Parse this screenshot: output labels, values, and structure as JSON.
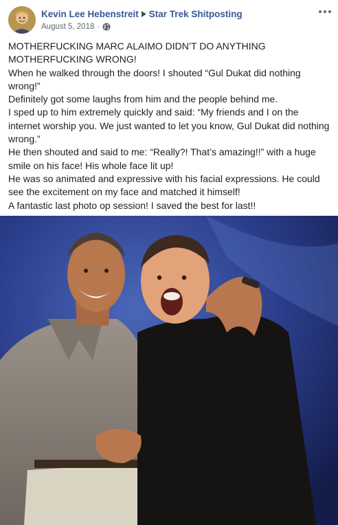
{
  "post": {
    "author": "Kevin Lee Hebenstreit",
    "group": "Star Trek Shitposting",
    "date": "August 5, 2018",
    "date_separator": "·",
    "icons": {
      "separator": "triangle-right-icon",
      "privacy": "globe-icon",
      "menu": "more-options-icon"
    },
    "paragraphs": [
      "MOTHERFUCKING MARC ALAIMO DIDN’T DO ANYTHING MOTHERFUCKING WRONG!",
      "When he walked through the doors! I shouted “Gul Dukat did nothing wrong!”",
      "Definitely got some laughs from him and the people behind me.",
      "I sped up to him extremely quickly and said: “My friends and I on the internet worship you. We just wanted to let you know, Gul Dukat did nothing wrong.”",
      "He then shouted and said to me: “Really?! That’s amazing!!” with a huge smile on his face! His whole face lit up!",
      "He was so animated and expressive with his facial expressions. He could see the excitement on my face and matched it himself!",
      "A fantastic last photo op session! I saved the best for last!!"
    ]
  },
  "colors": {
    "link_blue": "#385898",
    "meta_gray": "#606770",
    "text": "#1c1e21",
    "photo_backdrop": "#24327a"
  }
}
